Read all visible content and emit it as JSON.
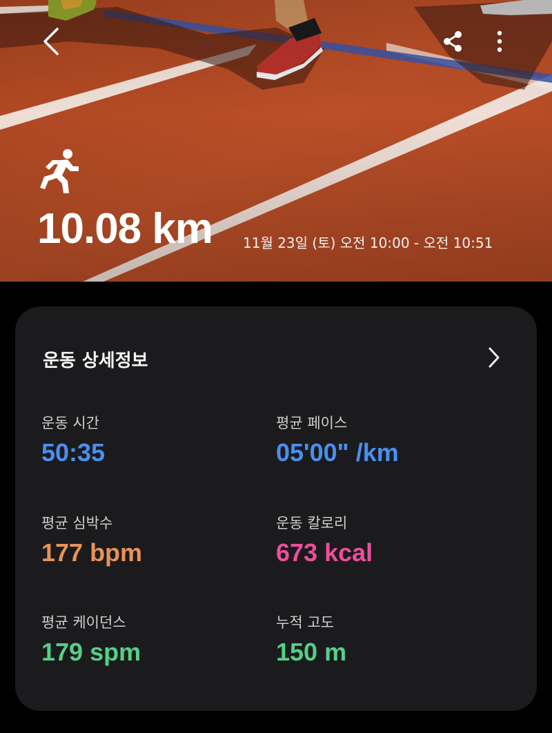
{
  "header": {
    "back_icon": "chevron-left-icon",
    "share_icon": "share-icon",
    "more_icon": "more-vertical-icon",
    "activity_icon": "running-icon",
    "distance": "10.08 km",
    "datetime": "11월 23일 (토) 오전 10:00 - 오전 10:51"
  },
  "details": {
    "title": "운동 상세정보",
    "chevron_icon": "chevron-right-icon",
    "stats": [
      {
        "label": "운동 시간",
        "value": "50:35",
        "color": "#4a8ff0"
      },
      {
        "label": "평균 페이스",
        "value": "05'00\" /km",
        "color": "#4a8ff0"
      },
      {
        "label": "평균 심박수",
        "value": "177 bpm",
        "color": "#e8925a"
      },
      {
        "label": "운동 칼로리",
        "value": "673 kcal",
        "color": "#ec4f9a"
      },
      {
        "label": "평균 케이던스",
        "value": "179 spm",
        "color": "#55cf88"
      },
      {
        "label": "누적 고도",
        "value": "150 m",
        "color": "#55cf88"
      }
    ]
  }
}
